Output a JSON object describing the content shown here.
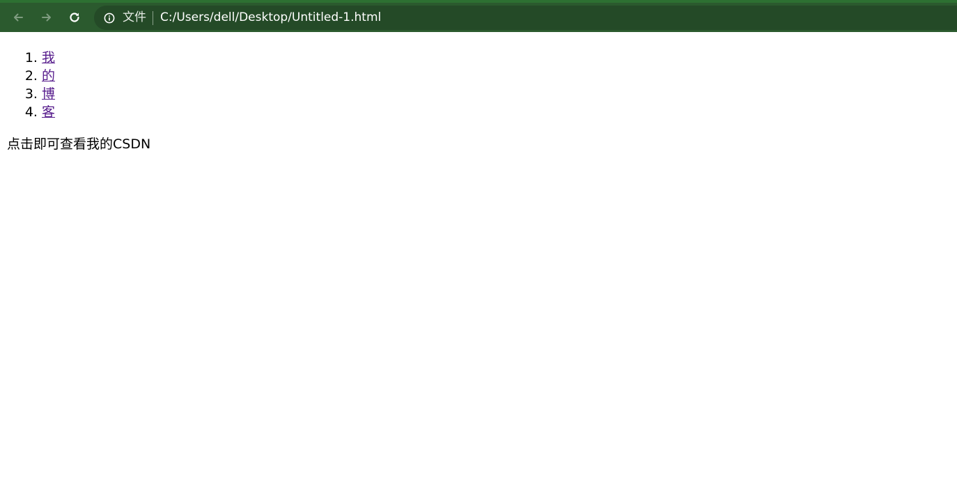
{
  "browser": {
    "scheme_label": "文件",
    "url": "C:/Users/dell/Desktop/Untitled-1.html",
    "colors": {
      "toolbar": "#2b5a2e",
      "omnibox": "#244a27"
    }
  },
  "page": {
    "list_items": [
      {
        "label": "我"
      },
      {
        "label": "的"
      },
      {
        "label": "博"
      },
      {
        "label": "客"
      }
    ],
    "caption": "点击即可查看我的CSDN",
    "link_color": "#551a8b"
  },
  "icons": {
    "back": "arrow-left-icon",
    "forward": "arrow-right-icon",
    "reload": "reload-icon",
    "info": "info-circle-icon"
  }
}
